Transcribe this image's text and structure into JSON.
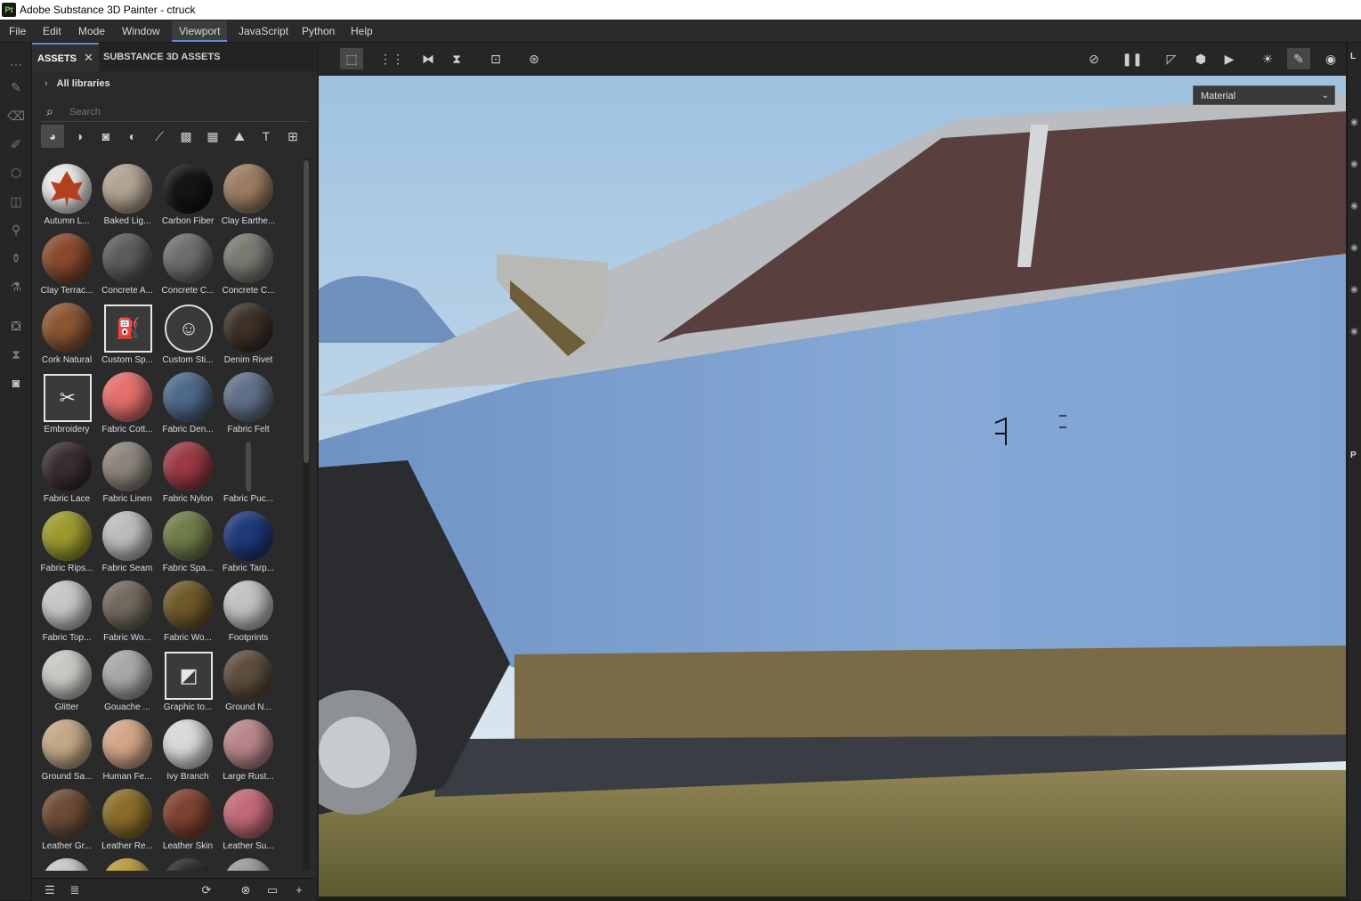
{
  "app": {
    "logo_text": "Pt",
    "window_title": "Adobe Substance 3D Painter - ctruck"
  },
  "menu": [
    "File",
    "Edit",
    "Mode",
    "Window",
    "Viewport",
    "JavaScript",
    "Python",
    "Help"
  ],
  "menu_active": "Viewport",
  "assets_panel": {
    "tabs": {
      "assets": "ASSETS",
      "substance": "SUBSTANCE 3D ASSETS",
      "close": "✕"
    },
    "breadcrumb": "All libraries",
    "search_placeholder": "Search"
  },
  "viewport": {
    "display_mode": "Material"
  },
  "right_panel": {
    "top_label": "L",
    "mid_label": "P"
  },
  "assets": [
    "Autumn L...",
    "Baked Lig...",
    "Carbon Fiber",
    "Clay Earthe...",
    "Clay Terrac...",
    "Concrete A...",
    "Concrete C...",
    "Concrete C...",
    "Cork Natural",
    "Custom Sp...",
    "Custom Sti...",
    "Denim Rivet",
    "Embroidery",
    "Fabric Cott...",
    "Fabric Den...",
    "Fabric Felt",
    "Fabric Lace",
    "Fabric Linen",
    "Fabric Nylon",
    "Fabric Puc...",
    "Fabric Rips...",
    "Fabric Seam",
    "Fabric Spa...",
    "Fabric Tarp...",
    "Fabric Top...",
    "Fabric Wo...",
    "Fabric Wo...",
    "Footprints",
    "Glitter",
    "Gouache ...",
    "Graphic to...",
    "Ground N...",
    "Ground Sa...",
    "Human Fe...",
    "Ivy Branch",
    "Large Rust...",
    "Leather Gr...",
    "Leather Re...",
    "Leather Skin",
    "Leather Su..."
  ],
  "colors": {
    "accent": "#5a8fd6",
    "panel": "#2a2a2a",
    "truck_body": "#7fa3cf"
  }
}
